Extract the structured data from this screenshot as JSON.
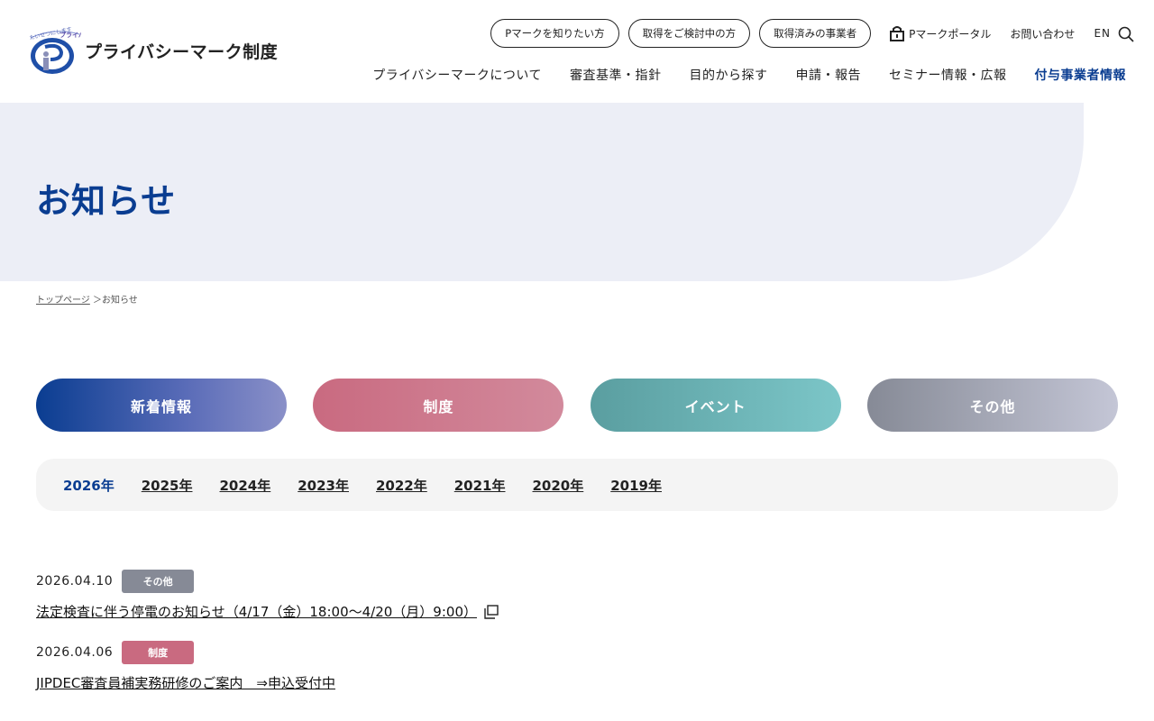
{
  "header": {
    "logo_text": "プライバシーマーク制度",
    "logo_tagline": "たいせつにしますプライバシー",
    "top_links": [
      {
        "label": "Pマークを知りたい方"
      },
      {
        "label": "取得をご検討中の方"
      },
      {
        "label": "取得済みの事業者"
      }
    ],
    "portal_label": "Pマークポータル",
    "contact_label": "お問い合わせ",
    "lang_label": "EN",
    "nav": [
      {
        "label": "プライバシーマークについて"
      },
      {
        "label": "審査基準・指針"
      },
      {
        "label": "目的から探す"
      },
      {
        "label": "申請・報告"
      },
      {
        "label": "セミナー情報・広報"
      },
      {
        "label": "付与事業者情報"
      }
    ]
  },
  "hero": {
    "title": "お知らせ"
  },
  "breadcrumb": {
    "home": "トップページ",
    "sep": "＞",
    "current": "お知らせ"
  },
  "categories": [
    {
      "label": "新着情報"
    },
    {
      "label": "制度"
    },
    {
      "label": "イベント"
    },
    {
      "label": "その他"
    }
  ],
  "years": [
    {
      "label": "2026年",
      "active": true
    },
    {
      "label": "2025年"
    },
    {
      "label": "2024年"
    },
    {
      "label": "2023年"
    },
    {
      "label": "2022年"
    },
    {
      "label": "2021年"
    },
    {
      "label": "2020年"
    },
    {
      "label": "2019年"
    }
  ],
  "news": [
    {
      "date": "2026.04.10",
      "tag": "その他",
      "title": "法定検査に伴う停電のお知らせ（4/17（金）18:00～4/20（月）9:00）"
    },
    {
      "date": "2026.04.06",
      "tag": "制度",
      "title": "JIPDEC審査員補実務研修のご案内　⇒申込受付中"
    }
  ],
  "colors": {
    "brand": "#0a3d91",
    "hero_bg": "#eceef6",
    "tag_other": "#868a96",
    "tag_system": "#c96a80"
  }
}
